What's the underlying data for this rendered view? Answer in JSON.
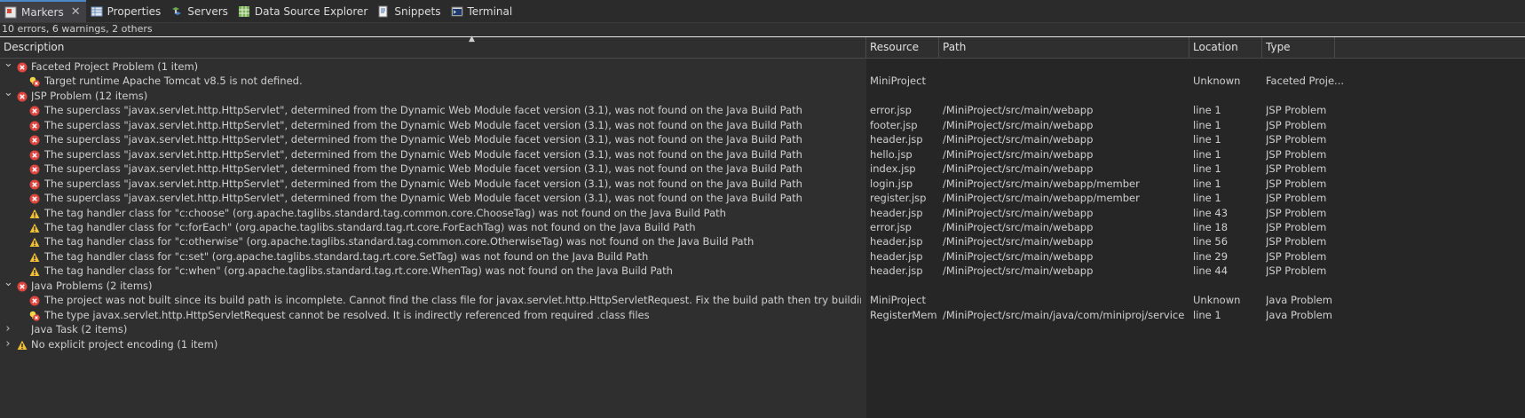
{
  "tabs": [
    {
      "label": "Markers",
      "icon": "markers-icon",
      "active": true
    },
    {
      "label": "Properties",
      "icon": "properties-icon"
    },
    {
      "label": "Servers",
      "icon": "servers-icon"
    },
    {
      "label": "Data Source Explorer",
      "icon": "data-source-explorer-icon"
    },
    {
      "label": "Snippets",
      "icon": "snippets-icon"
    },
    {
      "label": "Terminal",
      "icon": "terminal-icon"
    }
  ],
  "summary": "10 errors, 6 warnings, 2 others",
  "columns": [
    "Description",
    "Resource",
    "Path",
    "Location",
    "Type"
  ],
  "colors": {
    "error": "#e0463f",
    "warning": "#f0c03a",
    "background": "#2f2f2f",
    "rightArea": "#262626"
  },
  "groups": [
    {
      "label": "Faceted Project Problem (1 item)",
      "icon": "error",
      "expanded": true,
      "items": [
        {
          "icon": "error-quickfix",
          "description": "Target runtime Apache Tomcat v8.5 is not defined.",
          "resource": "MiniProject",
          "path": "",
          "location": "Unknown",
          "type": "Faceted Proje..."
        }
      ]
    },
    {
      "label": "JSP Problem (12 items)",
      "icon": "error",
      "expanded": true,
      "items": [
        {
          "icon": "error",
          "description": "The superclass \"javax.servlet.http.HttpServlet\", determined from the Dynamic Web Module facet version (3.1), was not found on the Java Build Path",
          "resource": "error.jsp",
          "path": "/MiniProject/src/main/webapp",
          "location": "line 1",
          "type": "JSP Problem"
        },
        {
          "icon": "error",
          "description": "The superclass \"javax.servlet.http.HttpServlet\", determined from the Dynamic Web Module facet version (3.1), was not found on the Java Build Path",
          "resource": "footer.jsp",
          "path": "/MiniProject/src/main/webapp",
          "location": "line 1",
          "type": "JSP Problem"
        },
        {
          "icon": "error",
          "description": "The superclass \"javax.servlet.http.HttpServlet\", determined from the Dynamic Web Module facet version (3.1), was not found on the Java Build Path",
          "resource": "header.jsp",
          "path": "/MiniProject/src/main/webapp",
          "location": "line 1",
          "type": "JSP Problem"
        },
        {
          "icon": "error",
          "description": "The superclass \"javax.servlet.http.HttpServlet\", determined from the Dynamic Web Module facet version (3.1), was not found on the Java Build Path",
          "resource": "hello.jsp",
          "path": "/MiniProject/src/main/webapp",
          "location": "line 1",
          "type": "JSP Problem"
        },
        {
          "icon": "error",
          "description": "The superclass \"javax.servlet.http.HttpServlet\", determined from the Dynamic Web Module facet version (3.1), was not found on the Java Build Path",
          "resource": "index.jsp",
          "path": "/MiniProject/src/main/webapp",
          "location": "line 1",
          "type": "JSP Problem"
        },
        {
          "icon": "error",
          "description": "The superclass \"javax.servlet.http.HttpServlet\", determined from the Dynamic Web Module facet version (3.1), was not found on the Java Build Path",
          "resource": "login.jsp",
          "path": "/MiniProject/src/main/webapp/member",
          "location": "line 1",
          "type": "JSP Problem"
        },
        {
          "icon": "error",
          "description": "The superclass \"javax.servlet.http.HttpServlet\", determined from the Dynamic Web Module facet version (3.1), was not found on the Java Build Path",
          "resource": "register.jsp",
          "path": "/MiniProject/src/main/webapp/member",
          "location": "line 1",
          "type": "JSP Problem"
        },
        {
          "icon": "warning",
          "description": "The tag handler class for \"c:choose\" (org.apache.taglibs.standard.tag.common.core.ChooseTag) was not found on the Java Build Path",
          "resource": "header.jsp",
          "path": "/MiniProject/src/main/webapp",
          "location": "line 43",
          "type": "JSP Problem"
        },
        {
          "icon": "warning",
          "description": "The tag handler class for \"c:forEach\" (org.apache.taglibs.standard.tag.rt.core.ForEachTag) was not found on the Java Build Path",
          "resource": "error.jsp",
          "path": "/MiniProject/src/main/webapp",
          "location": "line 18",
          "type": "JSP Problem"
        },
        {
          "icon": "warning",
          "description": "The tag handler class for \"c:otherwise\" (org.apache.taglibs.standard.tag.common.core.OtherwiseTag) was not found on the Java Build Path",
          "resource": "header.jsp",
          "path": "/MiniProject/src/main/webapp",
          "location": "line 56",
          "type": "JSP Problem"
        },
        {
          "icon": "warning",
          "description": "The tag handler class for \"c:set\" (org.apache.taglibs.standard.tag.rt.core.SetTag) was not found on the Java Build Path",
          "resource": "header.jsp",
          "path": "/MiniProject/src/main/webapp",
          "location": "line 29",
          "type": "JSP Problem"
        },
        {
          "icon": "warning",
          "description": "The tag handler class for \"c:when\" (org.apache.taglibs.standard.tag.rt.core.WhenTag) was not found on the Java Build Path",
          "resource": "header.jsp",
          "path": "/MiniProject/src/main/webapp",
          "location": "line 44",
          "type": "JSP Problem"
        }
      ]
    },
    {
      "label": "Java Problems (2 items)",
      "icon": "error",
      "expanded": true,
      "items": [
        {
          "icon": "error",
          "description": "The project was not built since its build path is incomplete. Cannot find the class file for javax.servlet.http.HttpServletRequest. Fix the build path then try building this project",
          "resource": "MiniProject",
          "path": "",
          "location": "Unknown",
          "type": "Java Problem"
        },
        {
          "icon": "error-quickfix",
          "description": "The type javax.servlet.http.HttpServletRequest cannot be resolved. It is indirectly referenced from required .class files",
          "resource": "RegisterMem...",
          "path": "/MiniProject/src/main/java/com/miniproj/service",
          "location": "line 1",
          "type": "Java Problem"
        }
      ]
    },
    {
      "label": "Java Task (2 items)",
      "icon": "none",
      "expanded": false,
      "items": []
    },
    {
      "label": "No explicit project encoding (1 item)",
      "icon": "warning",
      "expanded": false,
      "items": []
    }
  ]
}
